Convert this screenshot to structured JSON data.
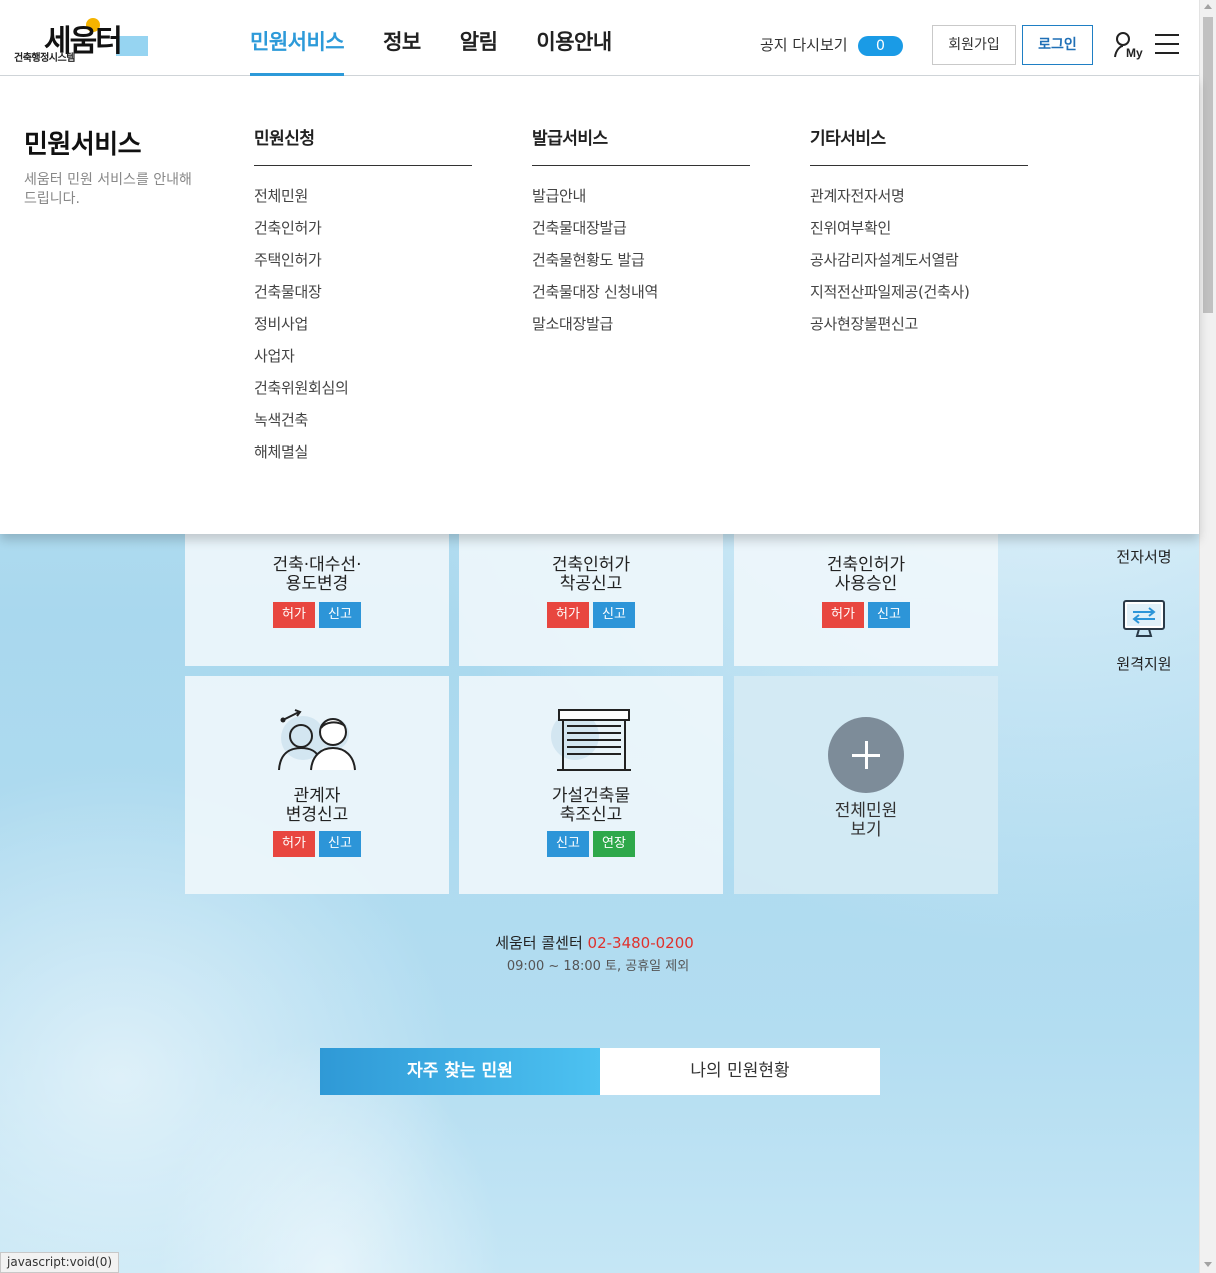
{
  "logo": {
    "mark": "세움터",
    "subtitle": "건축행정시스템"
  },
  "gnb": [
    {
      "label": "민원서비스",
      "active": true
    },
    {
      "label": "정보",
      "active": false
    },
    {
      "label": "알림",
      "active": false
    },
    {
      "label": "이용안내",
      "active": false
    }
  ],
  "header": {
    "notice_replay": "공지 다시보기",
    "notice_count": "0",
    "join_label": "회원가입",
    "login_label": "로그인"
  },
  "mega": {
    "title": "민원서비스",
    "desc": "세움터 민원 서비스를 안내해드립니다.",
    "columns": [
      {
        "heading": "민원신청",
        "items": [
          "전체민원",
          "건축인허가",
          "주택인허가",
          "건축물대장",
          "정비사업",
          "사업자",
          "건축위원회심의",
          "녹색건축",
          "해체멸실"
        ]
      },
      {
        "heading": "발급서비스",
        "items": [
          "발급안내",
          "건축물대장발급",
          "건축물현황도 발급",
          "건축물대장 신청내역",
          "말소대장발급"
        ]
      },
      {
        "heading": "기타서비스",
        "items": [
          "관계자전자서명",
          "진위여부확인",
          "공사감리자설계도서열람",
          "지적전산파일제공(건축사)",
          "공사현장불편신고"
        ]
      }
    ]
  },
  "tiles": [
    {
      "line1": "건축·대수선·",
      "line2": "용도변경",
      "tags": [
        {
          "label": "허가",
          "color": "red"
        },
        {
          "label": "신고",
          "color": "blue"
        }
      ]
    },
    {
      "line1": "건축인허가",
      "line2": "착공신고",
      "tags": [
        {
          "label": "허가",
          "color": "red"
        },
        {
          "label": "신고",
          "color": "blue"
        }
      ]
    },
    {
      "line1": "건축인허가",
      "line2": "사용승인",
      "tags": [
        {
          "label": "허가",
          "color": "red"
        },
        {
          "label": "신고",
          "color": "blue"
        }
      ]
    },
    {
      "line1": "관계자",
      "line2": "변경신고",
      "tags": [
        {
          "label": "허가",
          "color": "red"
        },
        {
          "label": "신고",
          "color": "blue"
        }
      ]
    },
    {
      "line1": "가설건축물",
      "line2": "축조신고",
      "tags": [
        {
          "label": "신고",
          "color": "blue"
        },
        {
          "label": "연장",
          "color": "green"
        }
      ]
    }
  ],
  "more_tile": {
    "line1": "전체민원",
    "line2": "보기"
  },
  "quick": {
    "esign": "전자서명",
    "remote": "원격지원"
  },
  "callcenter": {
    "label": "세움터 콜센터",
    "number": "02-3480-0200",
    "hours": "09:00 ~ 18:00 토, 공휴일 제외"
  },
  "tabs": [
    {
      "label": "자주 찾는 민원",
      "on": true
    },
    {
      "label": "나의 민원현황",
      "on": false
    }
  ],
  "status_bar": "javascript:void(0)",
  "colors": {
    "accent": "#2d9ad9",
    "tag_red": "#e8463f",
    "tag_blue": "#2d95d8",
    "tag_green": "#2ea84a",
    "call_number": "#e0312c"
  }
}
